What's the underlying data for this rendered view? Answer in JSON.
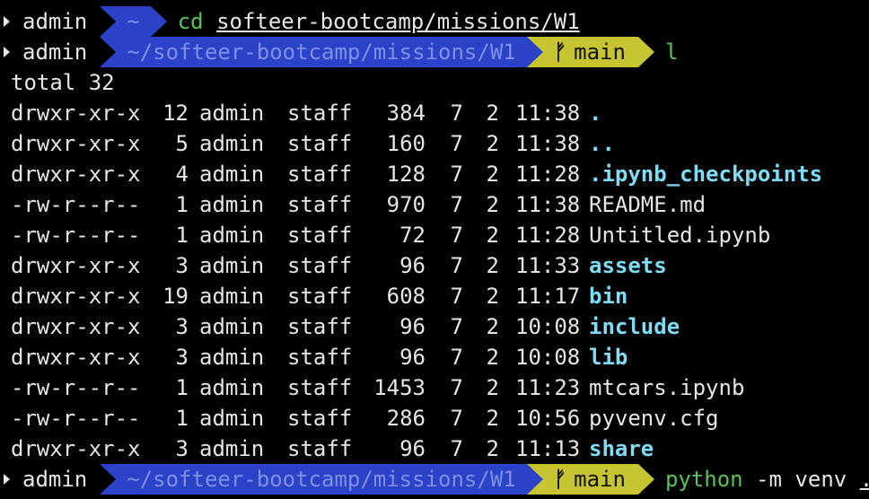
{
  "prompt1": {
    "user": "admin",
    "dir": "~",
    "command": "cd",
    "arg": "softeer-bootcamp/missions/W1"
  },
  "prompt2": {
    "user": "admin",
    "dir": "~/softeer-bootcamp/missions/W1",
    "branch_icon": "ᚠ",
    "branch": "main",
    "command": "l"
  },
  "total_line": "total 32",
  "listing": [
    {
      "perm": "drwxr-xr-x",
      "links": "12",
      "user": "admin",
      "group": "staff",
      "size": "384",
      "month": "7",
      "day": "2",
      "time": "11:38",
      "name": ".",
      "type": "dir"
    },
    {
      "perm": "drwxr-xr-x",
      "links": "5",
      "user": "admin",
      "group": "staff",
      "size": "160",
      "month": "7",
      "day": "2",
      "time": "11:38",
      "name": "..",
      "type": "dir"
    },
    {
      "perm": "drwxr-xr-x",
      "links": "4",
      "user": "admin",
      "group": "staff",
      "size": "128",
      "month": "7",
      "day": "2",
      "time": "11:28",
      "name": ".ipynb_checkpoints",
      "type": "dir"
    },
    {
      "perm": "-rw-r--r--",
      "links": "1",
      "user": "admin",
      "group": "staff",
      "size": "970",
      "month": "7",
      "day": "2",
      "time": "11:38",
      "name": "README.md",
      "type": "file"
    },
    {
      "perm": "-rw-r--r--",
      "links": "1",
      "user": "admin",
      "group": "staff",
      "size": "72",
      "month": "7",
      "day": "2",
      "time": "11:28",
      "name": "Untitled.ipynb",
      "type": "file"
    },
    {
      "perm": "drwxr-xr-x",
      "links": "3",
      "user": "admin",
      "group": "staff",
      "size": "96",
      "month": "7",
      "day": "2",
      "time": "11:33",
      "name": "assets",
      "type": "dir"
    },
    {
      "perm": "drwxr-xr-x",
      "links": "19",
      "user": "admin",
      "group": "staff",
      "size": "608",
      "month": "7",
      "day": "2",
      "time": "11:17",
      "name": "bin",
      "type": "dir"
    },
    {
      "perm": "drwxr-xr-x",
      "links": "3",
      "user": "admin",
      "group": "staff",
      "size": "96",
      "month": "7",
      "day": "2",
      "time": "10:08",
      "name": "include",
      "type": "dir"
    },
    {
      "perm": "drwxr-xr-x",
      "links": "3",
      "user": "admin",
      "group": "staff",
      "size": "96",
      "month": "7",
      "day": "2",
      "time": "10:08",
      "name": "lib",
      "type": "dir"
    },
    {
      "perm": "-rw-r--r--",
      "links": "1",
      "user": "admin",
      "group": "staff",
      "size": "1453",
      "month": "7",
      "day": "2",
      "time": "11:23",
      "name": "mtcars.ipynb",
      "type": "file"
    },
    {
      "perm": "-rw-r--r--",
      "links": "1",
      "user": "admin",
      "group": "staff",
      "size": "286",
      "month": "7",
      "day": "2",
      "time": "10:56",
      "name": "pyvenv.cfg",
      "type": "file"
    },
    {
      "perm": "drwxr-xr-x",
      "links": "3",
      "user": "admin",
      "group": "staff",
      "size": "96",
      "month": "7",
      "day": "2",
      "time": "11:13",
      "name": "share",
      "type": "dir"
    }
  ],
  "prompt3": {
    "user": "admin",
    "dir": "~/softeer-bootcamp/missions/W1",
    "branch_icon": "ᚠ",
    "branch": "main",
    "command": "python",
    "args": " -m venv ",
    "cursor": "."
  },
  "colors": {
    "background": "#000000",
    "dir_segment": "#2b43c8",
    "git_segment": "#c6c431",
    "command": "#56c456",
    "directory_name": "#7fdcf5"
  }
}
